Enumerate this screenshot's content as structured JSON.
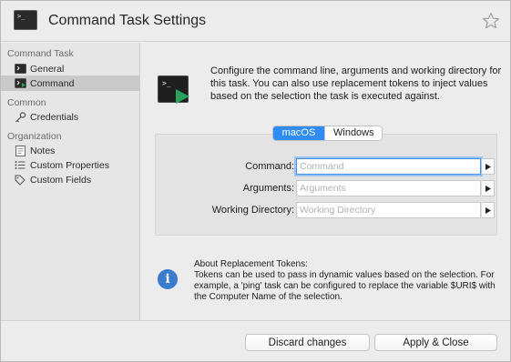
{
  "window": {
    "title": "Command Task Settings",
    "favorite_icon": "star-outline-icon"
  },
  "sidebar": {
    "sections": [
      {
        "header": "Command Task",
        "items": [
          {
            "label": "General",
            "icon": "terminal-icon",
            "selected": false
          },
          {
            "label": "Command",
            "icon": "command-icon",
            "selected": true
          }
        ]
      },
      {
        "header": "Common",
        "items": [
          {
            "label": "Credentials",
            "icon": "key-icon",
            "selected": false
          }
        ]
      },
      {
        "header": "Organization",
        "items": [
          {
            "label": "Notes",
            "icon": "notes-icon",
            "selected": false
          },
          {
            "label": "Custom Properties",
            "icon": "list-icon",
            "selected": false
          },
          {
            "label": "Custom Fields",
            "icon": "tag-icon",
            "selected": false
          }
        ]
      }
    ]
  },
  "main": {
    "description": "Configure the command line, arguments and working directory for this task. You can also use replacement tokens to inject values based on the selection the task is executed against.",
    "tabs": [
      {
        "label": "macOS",
        "active": true
      },
      {
        "label": "Windows",
        "active": false
      }
    ],
    "form": {
      "command": {
        "label": "Command:",
        "value": "",
        "placeholder": "Command"
      },
      "arguments": {
        "label": "Arguments:",
        "value": "",
        "placeholder": "Arguments"
      },
      "working_directory": {
        "label": "Working Directory:",
        "value": "",
        "placeholder": "Working Directory"
      }
    },
    "info": {
      "title": "About Replacement Tokens:",
      "body": "Tokens can be used to pass in dynamic values based on the selection. For example, a 'ping' task can be configured to replace the variable $URI$ with the Computer Name of the selection."
    }
  },
  "footer": {
    "discard_label": "Discard changes",
    "apply_label": "Apply & Close"
  },
  "colors": {
    "accent": "#2f8cf3",
    "info": "#3a7ccc",
    "play_green": "#27a35a",
    "selected_row": "#c9c9c9"
  }
}
